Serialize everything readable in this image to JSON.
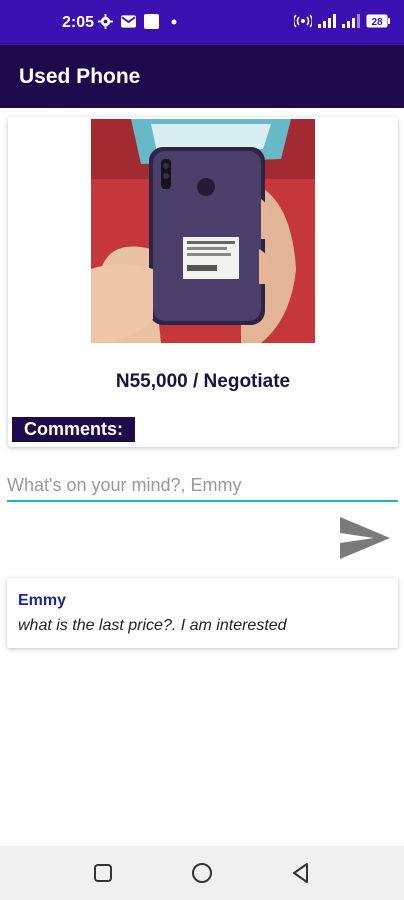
{
  "status_bar": {
    "time": "2:05",
    "icons": [
      "settings-icon",
      "mail-icon",
      "notification-icon",
      "dot-icon",
      "hotspot-icon",
      "signal-icon",
      "signal-icon",
      "battery-icon"
    ],
    "battery": "28"
  },
  "app_bar": {
    "title": "Used Phone"
  },
  "product": {
    "price": "N55,000 / Negotiate"
  },
  "comments_section": {
    "label": "Comments:"
  },
  "comment_input": {
    "placeholder": "What's on your mind?, Emmy",
    "value": ""
  },
  "comments": [
    {
      "author": "Emmy",
      "text": "what is the last price?. I am interested"
    }
  ],
  "colors": {
    "status_bar": "#3a10b0",
    "app_bar": "#1e0a4a",
    "accent": "#1fb8b0",
    "author": "#1a2b8c"
  }
}
